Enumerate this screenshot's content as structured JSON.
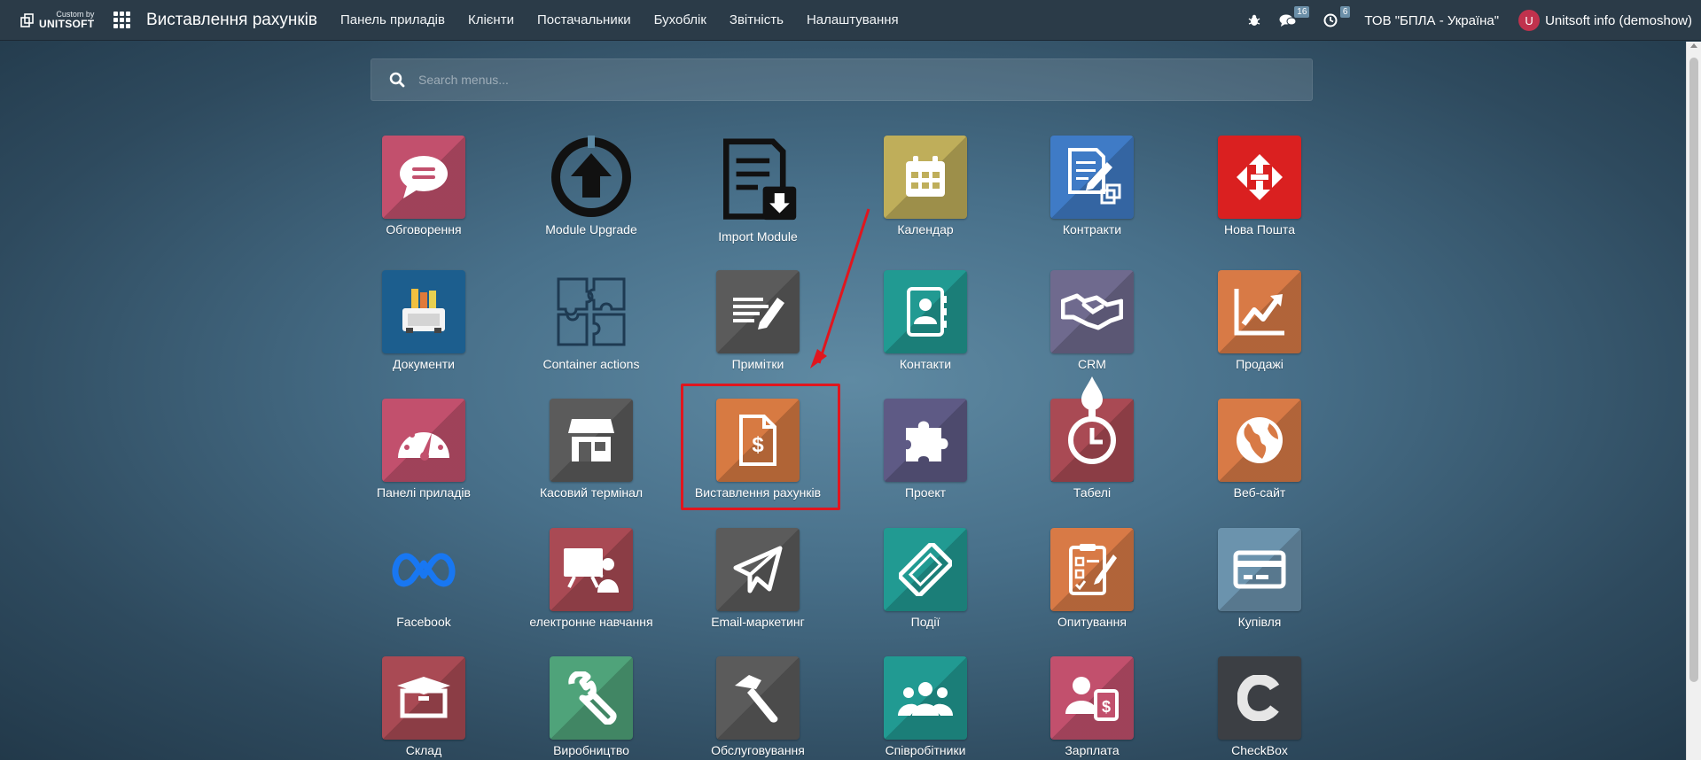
{
  "navbar": {
    "brand_small": "Custom by",
    "brand_big": "UNITSOFT",
    "app_title": "Виставлення рахунків",
    "menu": [
      "Панель приладів",
      "Клієнти",
      "Постачальники",
      "Бухоблік",
      "Звітність",
      "Налаштування"
    ],
    "messages_count": "16",
    "activities_count": "6",
    "company": "ТОВ \"БПЛА - Україна\"",
    "user_initial": "U",
    "user_name": "Unitsoft info (demoshow)"
  },
  "search": {
    "placeholder": "Search menus..."
  },
  "apps": [
    {
      "label": "Обговорення",
      "icon": "chat-bubble-icon",
      "color": "#c2506d"
    },
    {
      "label": "Module Upgrade",
      "icon": "upgrade-arrow-icon",
      "color": ""
    },
    {
      "label": "Import Module",
      "icon": "import-document-icon",
      "color": ""
    },
    {
      "label": "Календар",
      "icon": "calendar-icon",
      "color": "#bfae5a"
    },
    {
      "label": "Контракти",
      "icon": "contract-edit-icon",
      "color": "#3f7bc6"
    },
    {
      "label": "Нова Пошта",
      "icon": "nova-poshta-logo-icon",
      "color": "#da2020"
    },
    {
      "label": "Документи",
      "icon": "documents-folder-icon",
      "color": "#1c5e8e"
    },
    {
      "label": "Container actions",
      "icon": "puzzle-outline-icon",
      "color": ""
    },
    {
      "label": "Примітки",
      "icon": "notes-pen-icon",
      "color": "#5b5b5b"
    },
    {
      "label": "Контакти",
      "icon": "contacts-book-icon",
      "color": "#219a92"
    },
    {
      "label": "CRM",
      "icon": "handshake-icon",
      "color": "#6f6a8e"
    },
    {
      "label": "Продажі",
      "icon": "sales-chart-icon",
      "color": "#d87a46"
    },
    {
      "label": "Панелі приладів",
      "icon": "gauge-icon",
      "color": "#c2506d"
    },
    {
      "label": "Касовий термінал",
      "icon": "shop-icon",
      "color": "#5b5b5b"
    },
    {
      "label": "Виставлення рахунків",
      "icon": "invoice-dollar-icon",
      "color": "#d77a42"
    },
    {
      "label": "Проект",
      "icon": "puzzle-piece-icon",
      "color": "#5e5a85"
    },
    {
      "label": "Табелі",
      "icon": "stopwatch-icon",
      "color": "#a94a54"
    },
    {
      "label": "Веб-сайт",
      "icon": "globe-icon",
      "color": "#d87a46"
    },
    {
      "label": "Facebook",
      "icon": "meta-logo-icon",
      "color": ""
    },
    {
      "label": "електронне навчання",
      "icon": "elearning-board-icon",
      "color": "#a94a54"
    },
    {
      "label": "Email-маркетинг",
      "icon": "paper-plane-icon",
      "color": "#5b5b5b"
    },
    {
      "label": "Події",
      "icon": "ticket-icon",
      "color": "#219a92"
    },
    {
      "label": "Опитування",
      "icon": "survey-checklist-icon",
      "color": "#d87a46"
    },
    {
      "label": "Купівля",
      "icon": "credit-card-icon",
      "color": "#6b93ad"
    },
    {
      "label": "Склад",
      "icon": "box-icon",
      "color": "#a94a54"
    },
    {
      "label": "Виробництво",
      "icon": "wrench-icon",
      "color": "#4fa37a"
    },
    {
      "label": "Обслуговування",
      "icon": "hammer-icon",
      "color": "#5b5b5b"
    },
    {
      "label": "Співробітники",
      "icon": "team-icon",
      "color": "#219a92"
    },
    {
      "label": "Зарплата",
      "icon": "payroll-user-icon",
      "color": "#c2506d"
    },
    {
      "label": "CheckBox",
      "icon": "checkbox-c-logo-icon",
      "color": "#3c3f44"
    }
  ],
  "annotation": {
    "highlighted_app": "Виставлення рахунків",
    "box_color": "#e0161e"
  }
}
